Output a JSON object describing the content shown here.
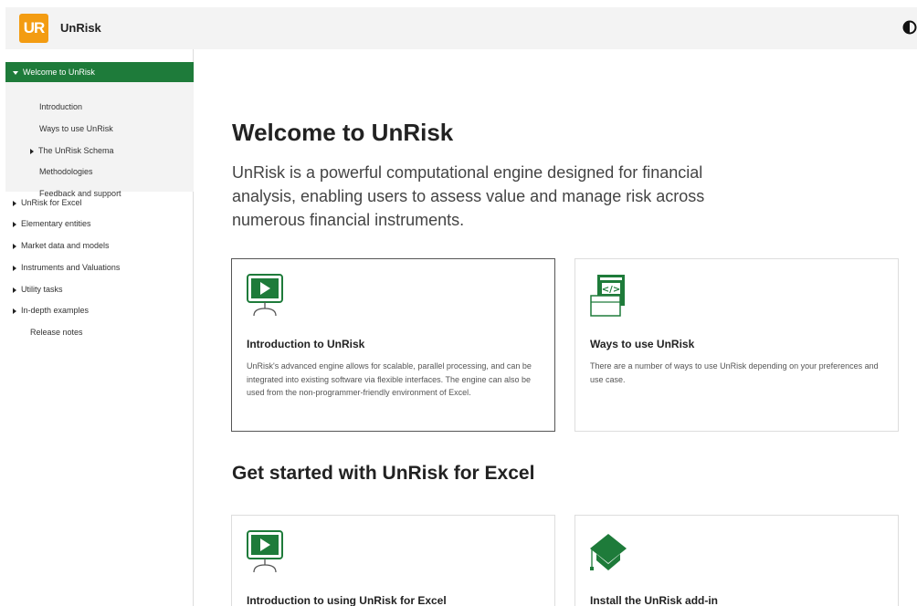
{
  "header": {
    "logo_text": "UR",
    "brand": "UnRisk"
  },
  "sidebar": {
    "active": "Welcome to UnRisk",
    "sub_items": [
      "Introduction",
      "Ways to use UnRisk",
      "The UnRisk Schema",
      "Methodologies",
      "Feedback and support"
    ],
    "items": [
      "UnRisk for Excel",
      "Elementary entities",
      "Market data and models",
      "Instruments and Valuations",
      "Utility tasks",
      "In-depth examples",
      "Release notes"
    ]
  },
  "main": {
    "title": "Welcome to UnRisk",
    "intro": "UnRisk is a powerful computational engine designed for financial analysis, enabling users to assess value and manage risk across numerous financial instruments.",
    "cards": [
      {
        "title": "Introduction to UnRisk",
        "desc": "UnRisk's advanced engine allows for scalable, parallel processing, and can be integrated into existing software via flexible interfaces. The engine can also be used from the non-programmer-friendly environment of Excel.",
        "icon": "presentation-play-icon"
      },
      {
        "title": "Ways to use UnRisk",
        "desc": "There are a number of ways to use UnRisk depending on your preferences and use case.",
        "icon": "code-window-icon"
      }
    ],
    "section2_title": "Get started with UnRisk for Excel",
    "cards2": [
      {
        "title": "Introduction to using UnRisk for Excel",
        "icon": "presentation-play-icon"
      },
      {
        "title": "Install the UnRisk add-in",
        "icon": "graduation-cap-icon"
      }
    ]
  },
  "colors": {
    "accent": "#1e7b3a",
    "logo": "#f39c12"
  }
}
